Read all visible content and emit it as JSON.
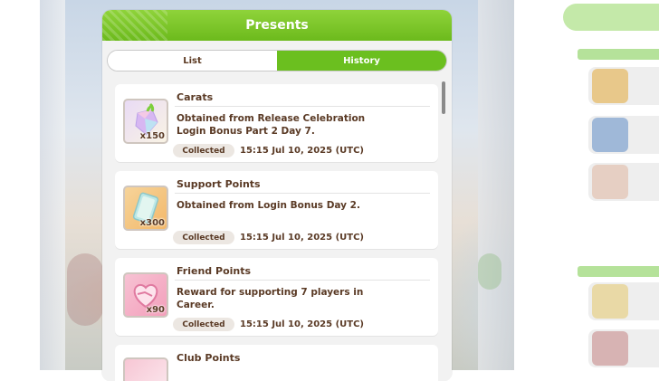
{
  "dialog": {
    "title": "Presents"
  },
  "tabs": [
    {
      "label": "List",
      "active": false
    },
    {
      "label": "History",
      "active": true
    }
  ],
  "items": [
    {
      "title": "Carats",
      "description": "Obtained from Release Celebration Login Bonus Part 2 Day 7.",
      "quantity": "x150",
      "status": "Collected",
      "timestamp": "15:15 Jul 10, 2025 (UTC)",
      "icon": "carat-icon"
    },
    {
      "title": "Support Points",
      "description": "Obtained from Login Bonus Day 2.",
      "quantity": "x300",
      "status": "Collected",
      "timestamp": "15:15 Jul 10, 2025 (UTC)",
      "icon": "support-point-ticket-icon"
    },
    {
      "title": "Friend Points",
      "description": "Reward for supporting 7 players in Career.",
      "quantity": "x90",
      "status": "Collected",
      "timestamp": "15:15 Jul 10, 2025 (UTC)",
      "icon": "handshake-heart-icon"
    },
    {
      "title": "Club Points",
      "icon": "club-point-icon"
    }
  ],
  "colors": {
    "header_green": "#6cba1c",
    "active_tab": "#6bbf1f",
    "text_brown": "#5a3a25"
  }
}
